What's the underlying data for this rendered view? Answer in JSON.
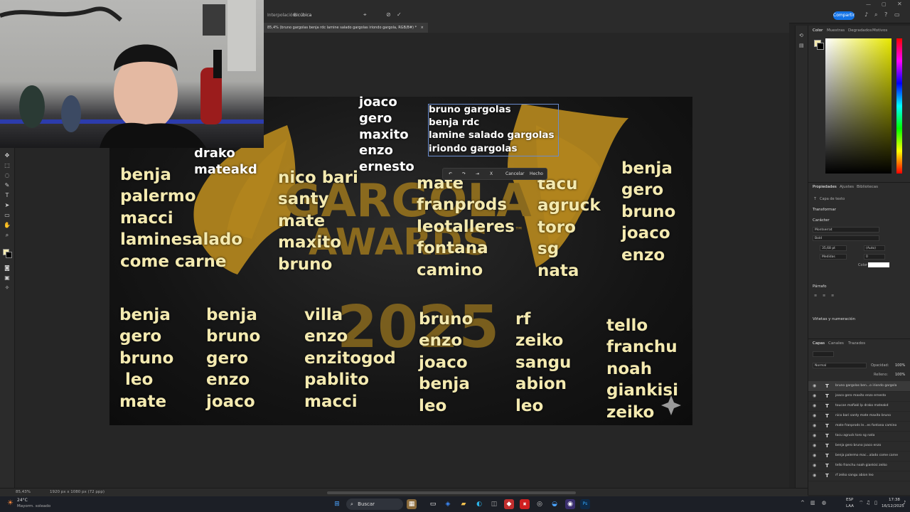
{
  "options_bar": {
    "interpolation_label": "Interpolación:",
    "interpolation_value": "Bicúbica",
    "share_label": "Compartir"
  },
  "document_tab": {
    "title": "85,4% (bruno gargolas benja rdc lamine salado gargolas iriondo gargola, RGB/8#) *",
    "close": "×"
  },
  "context_bar": {
    "cancel": "Cancelar",
    "done": "Hecho"
  },
  "canvas": {
    "columns_top": [
      "drako\nmateakd",
      "joaco\ngero\nmaxito\nenzo\nernesto",
      "bruno gargolas\nbenja rdc\nlamine salado gargolas\niriondo gargolas",
      "benja\npalermo\nmacci\nlaminesalado\ncome carne",
      "nico bari\nsanty\nmate\nmaxito\nbruno",
      "mate\nfranprods\nleotalleres\nfontana\ncamino",
      "tacu\nagruck\ntoro\nsg\nnata",
      "benja\ngero\nbruno\njoaco\nenzo"
    ],
    "columns_bottom": [
      "benja\ngero\nbruno\n leo\nmate",
      "benja\nbruno\ngero\nenzo\njoaco",
      "villa\nenzo\nenzitogod\npablito\nmacci",
      "bruno\nenzo\njoaco\nbenja\nleo",
      "rf\nzeiko\nsangu\nabion\nleo",
      "tello\nfranchu\nnoah\ngiankisi\nzeiko"
    ],
    "logo_line1": "GARGOLA",
    "logo_line2": "AWARDS",
    "logo_tm": "™",
    "logo_year": "2025"
  },
  "right_panel": {
    "color_tabs": [
      "Color",
      "Muestras",
      "Degradados",
      "Motivos"
    ],
    "props_tabs": [
      "Propiedades",
      "Ajustes",
      "Bibliotecas"
    ],
    "layer_type": "Capa de texto",
    "transform": "Transformar",
    "character": "Carácter",
    "font_family": "Montserrat",
    "font_style": "Bold",
    "font_size": "35,68 pt",
    "leading": "(Auto)",
    "tracking_mode": "Medidas",
    "tracking_value": "0",
    "color_label": "Color",
    "paragraph": "Párrafo",
    "bullets": "Viñetas y numeración",
    "layers_tabs": [
      "Capas",
      "Canales",
      "Trazados"
    ],
    "blend_mode": "Normal",
    "opacity_label": "Opacidad:",
    "opacity_value": "100%",
    "fill_label": "Relleno:",
    "fill_value": "100%",
    "layers": [
      "bruno gargolas ben...o iriondo gargola",
      "joaco gero maxito enzo ernesto",
      "toucan mafiakl lp drako mateakd",
      "nico bari santy mate maxito bruno",
      "mate franprods le...es fontana camino",
      "tacu agruck toro sg nata",
      "benja gero bruno joaco enzo",
      "benja palermo mac...alado come carne",
      "tello franchu noah giankisi zeiko",
      "rf zeiko sangu abion leo"
    ]
  },
  "status_bar": {
    "zoom": "85,43%",
    "doc_size": "1920 px x 1080 px (72 ppp)"
  },
  "taskbar": {
    "weather_temp": "24°C",
    "weather_desc": "Mayorm. soleado",
    "search": "Buscar",
    "lang1": "ESP",
    "lang2": "LAA",
    "time": "17:38",
    "date": "16/12/2025"
  }
}
